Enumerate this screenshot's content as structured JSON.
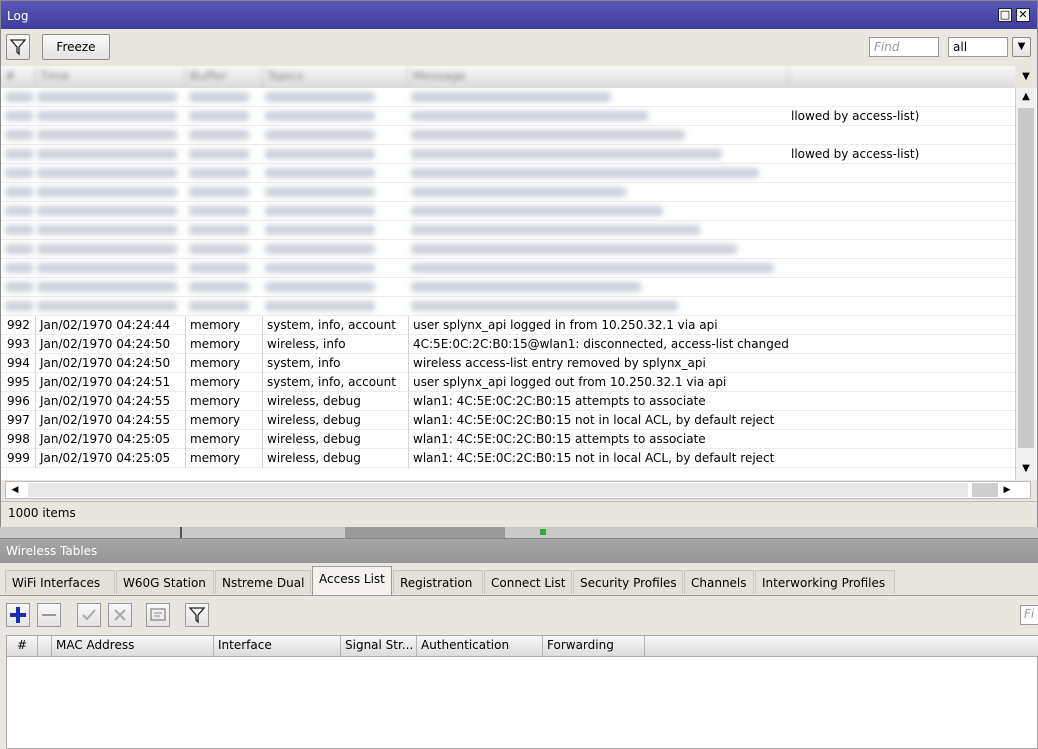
{
  "log_window": {
    "title": "Log",
    "toolbar": {
      "freeze_label": "Freeze",
      "find_placeholder": "Find",
      "filter_value": "all"
    },
    "blurred_tail_text": "llowed by access-list)",
    "rows": [
      {
        "num": "992",
        "time": "Jan/02/1970 04:24:44",
        "buffer": "memory",
        "topics": "system, info, account",
        "message": "user splynx_api logged in from 10.250.32.1 via api"
      },
      {
        "num": "993",
        "time": "Jan/02/1970 04:24:50",
        "buffer": "memory",
        "topics": "wireless, info",
        "message": "4C:5E:0C:2C:B0:15@wlan1: disconnected, access-list changed"
      },
      {
        "num": "994",
        "time": "Jan/02/1970 04:24:50",
        "buffer": "memory",
        "topics": "system, info",
        "message": "wireless access-list entry removed by splynx_api"
      },
      {
        "num": "995",
        "time": "Jan/02/1970 04:24:51",
        "buffer": "memory",
        "topics": "system, info, account",
        "message": "user splynx_api logged out from 10.250.32.1 via api"
      },
      {
        "num": "996",
        "time": "Jan/02/1970 04:24:55",
        "buffer": "memory",
        "topics": "wireless, debug",
        "message": "wlan1: 4C:5E:0C:2C:B0:15 attempts to associate"
      },
      {
        "num": "997",
        "time": "Jan/02/1970 04:24:55",
        "buffer": "memory",
        "topics": "wireless, debug",
        "message": "wlan1: 4C:5E:0C:2C:B0:15 not in local ACL, by default reject"
      },
      {
        "num": "998",
        "time": "Jan/02/1970 04:25:05",
        "buffer": "memory",
        "topics": "wireless, debug",
        "message": "wlan1: 4C:5E:0C:2C:B0:15 attempts to associate"
      },
      {
        "num": "999",
        "time": "Jan/02/1970 04:25:05",
        "buffer": "memory",
        "topics": "wireless, debug",
        "message": "wlan1: 4C:5E:0C:2C:B0:15 not in local ACL, by default reject"
      }
    ],
    "status": "1000 items"
  },
  "wireless_tables": {
    "title": "Wireless Tables",
    "tabs": [
      "WiFi Interfaces",
      "W60G Station",
      "Nstreme Dual",
      "Access List",
      "Registration",
      "Connect List",
      "Security Profiles",
      "Channels",
      "Interworking Profiles"
    ],
    "active_tab": "Access List",
    "find_placeholder": "Fi",
    "columns": [
      "#",
      "MAC Address",
      "Interface",
      "Signal Str...",
      "Authentication",
      "Forwarding"
    ]
  },
  "colors": {
    "titlebar": "#4a47a8",
    "window_bg": "#e9e6df",
    "add_icon": "#1a2fb0"
  }
}
